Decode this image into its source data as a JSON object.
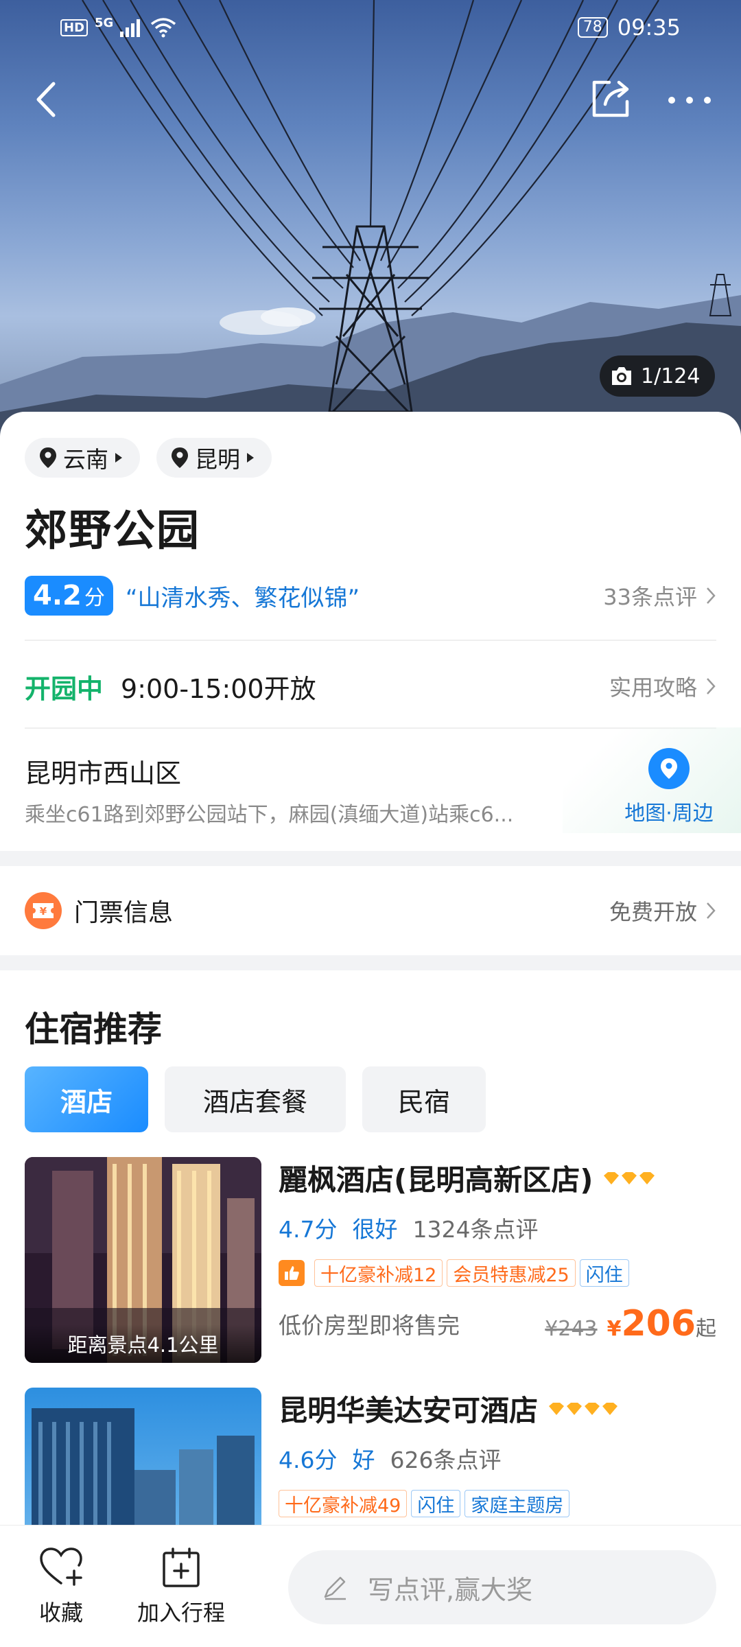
{
  "status_bar": {
    "network_badge": "HD",
    "signal": "5G",
    "battery": "78",
    "time": "09:35"
  },
  "hero": {
    "photo_counter": "1/124"
  },
  "breadcrumbs": [
    {
      "label": "云南"
    },
    {
      "label": "昆明"
    }
  ],
  "poi": {
    "title": "郊野公园",
    "score": "4.2",
    "score_unit": "分",
    "quote": "“山清水秀、繁花似锦”",
    "review_count": "33条点评",
    "open_status": "开园中",
    "open_hours": "9:00-15:00开放",
    "guide_link": "实用攻略",
    "address": "昆明市西山区",
    "transit": "乘坐c61路到郊野公园站下，麻园(滇缅大道)站乘c6...",
    "map_label": "地图·周边"
  },
  "ticket": {
    "label": "门票信息",
    "value": "免费开放"
  },
  "lodging": {
    "title": "住宿推荐",
    "tabs": [
      {
        "label": "酒店"
      },
      {
        "label": "酒店套餐"
      },
      {
        "label": "民宿"
      }
    ],
    "hotels": [
      {
        "name": "麗枫酒店(昆明高新区店)",
        "diamonds": 3,
        "score": "4.7分",
        "level": "很好",
        "reviews": "1324条点评",
        "distance": "距离景点4.1公里",
        "tags": [
          "十亿豪补减12",
          "会员特惠减25",
          "闪住"
        ],
        "price_note": "低价房型即将售完",
        "orig_price": "¥243",
        "currency": "¥",
        "price": "206",
        "price_suffix": "起"
      },
      {
        "name": "昆明华美达安可酒店",
        "diamonds": 4,
        "score": "4.6分",
        "level": "好",
        "reviews": "626条点评",
        "tags": [
          "十亿豪补减49",
          "闪住",
          "家庭主题房"
        ]
      }
    ]
  },
  "bottom_bar": {
    "favorite_label": "收藏",
    "itinerary_label": "加入行程",
    "review_placeholder": "写点评,赢大奖"
  },
  "colors": {
    "accent_blue": "#1a8cff",
    "open_green": "#14b36b",
    "price_orange": "#ff6a1a"
  }
}
